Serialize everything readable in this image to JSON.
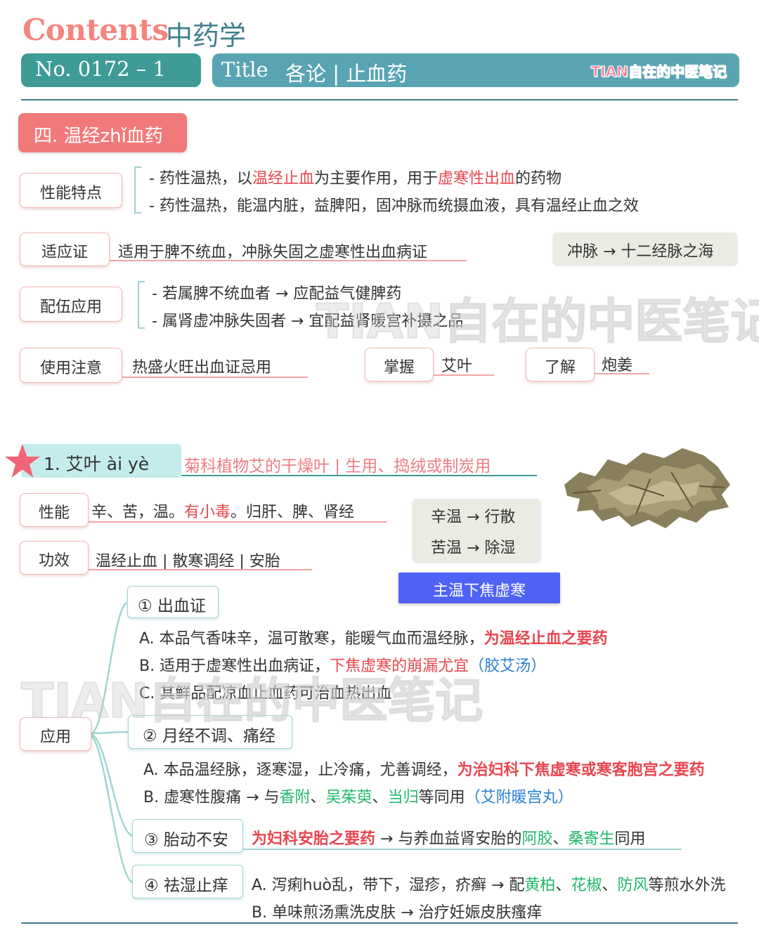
{
  "header": {
    "contents": "Contents",
    "subject": "中药学",
    "number": "No. 0172 – 1",
    "title_label": "Title",
    "title_text": "各论 | 止血药",
    "brand": "TIAN自在的中医笔记"
  },
  "section": {
    "title": "四. 温经zhǐ血药"
  },
  "properties": {
    "label": "性能特点",
    "line1": [
      "- 药性温热，以",
      "温经止血",
      "为主要作用，用于",
      "虚寒性出血",
      "的药物"
    ],
    "line2": "- 药性温热，能温内脏，益脾阳，固冲脉而统摄血液，具有温经止血之效"
  },
  "indication": {
    "label": "适应证",
    "text": "适用于脾不统血，冲脉失固之虚寒性出血病证",
    "note": "冲脉 → 十二经脉之海"
  },
  "combination": {
    "label": "配伍应用",
    "line1": "- 若属脾不统血者 → 应配益气健脾药",
    "line2": "- 属肾虚冲脉失固者 → 宜配益肾暖宫补摄之品"
  },
  "caution": {
    "label": "使用注意",
    "text": "热盛火旺出血证忌用",
    "master_label": "掌握",
    "master_value": "艾叶",
    "know_label": "了解",
    "know_value": "炮姜"
  },
  "herb": {
    "title": "1.  艾叶 ài yè",
    "source": "菊科植物艾的干燥叶 | 生用、捣绒或制炭用",
    "nature_label": "性能",
    "nature_a": "辛、苦，温。",
    "nature_toxic": "有小毒",
    "nature_b": "。归肝、脾、肾经",
    "effect_label": "功效",
    "effect_text": "温经止血 | 散寒调经 | 安胎",
    "taste1": "辛温 → 行散",
    "taste2": "苦温 → 除湿",
    "main_point": "主温下焦虚寒"
  },
  "application": {
    "label": "应用",
    "items": [
      {
        "title": "① 出血证",
        "a_plain": "A. 本品气香味辛，温可散寒，能暖气血而温经脉，",
        "a_red": "为温经止血之要药",
        "b_plain": "B. 适用于虚寒性出血病证，",
        "b_red": "下焦虚寒的崩漏尤宜",
        "b_blue": "（胶艾汤）",
        "c_plain": "C. 其鲜品配凉血止血药可治血热出血"
      },
      {
        "title": "② 月经不调、痛经",
        "a_plain": "A. 本品温经脉，逐寒湿，止冷痛，尤善调经，",
        "a_red": "为治妇科下焦虚寒或寒客胞宫之要药",
        "b_plain1": "B. 虚寒性腹痛 → 与",
        "b_g1": "香附",
        "b_sep1": "、",
        "b_g2": "吴茱萸",
        "b_sep2": "、",
        "b_g3": "当归",
        "b_plain2": "等同用",
        "b_blue": "（艾附暖宫丸）"
      },
      {
        "title": "③ 胎动不安",
        "red": "为妇科安胎之要药",
        "plain1": " → 与养血益肾安胎的",
        "g1": "阿胶",
        "sep": "、",
        "g2": "桑寄生",
        "plain2": "同用"
      },
      {
        "title": "④ 祛湿止痒",
        "a_plain1": "A. 泻痢huò乱，带下，湿疹，疥癣 → 配",
        "a_g1": "黄柏",
        "a_sep1": "、",
        "a_g2": "花椒",
        "a_sep2": "、",
        "a_g3": "防风",
        "a_plain2": "等煎水外洗",
        "b_plain": "B. 单味煎汤熏洗皮肤 → 治疗妊娠皮肤瘙痒"
      }
    ]
  },
  "watermark": "TIAN自在的中医笔记",
  "colors": {
    "teal": "#3e9b96",
    "title_bar": "#59a4b3",
    "coral": "#f27979",
    "red_text": "#e8464f",
    "green_text": "#20b86b",
    "blue_text": "#2a7fd4",
    "button_blue": "#4f62f6"
  }
}
